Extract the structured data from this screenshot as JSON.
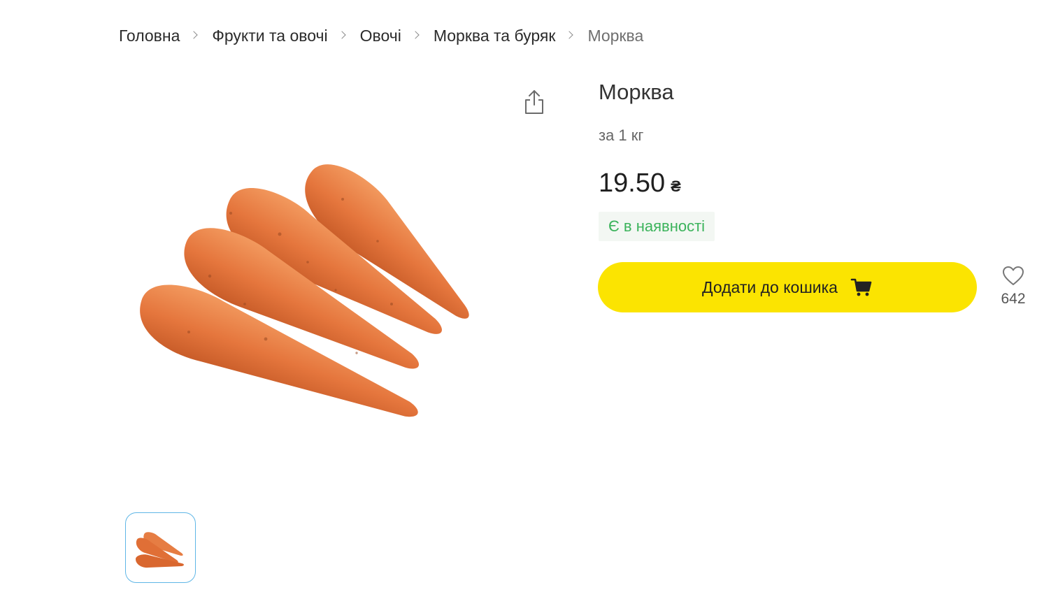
{
  "breadcrumb": {
    "items": [
      "Головна",
      "Фрукти та овочі",
      "Овочі",
      "Морква та буряк"
    ],
    "current": "Морква"
  },
  "product": {
    "title": "Морква",
    "unit": "за 1 кг",
    "price": "19.50",
    "currency": "₴",
    "availability": "Є в наявності",
    "add_to_cart_label": "Додати до кошика",
    "favorites_count": "642"
  },
  "colors": {
    "accent": "#fbe401",
    "in_stock_text": "#3bb35b",
    "in_stock_bg": "#f3f7f3",
    "thumb_border": "#5fb6e6"
  },
  "icons": {
    "share": "share-icon",
    "cart": "cart-icon",
    "favorite": "heart-icon"
  }
}
